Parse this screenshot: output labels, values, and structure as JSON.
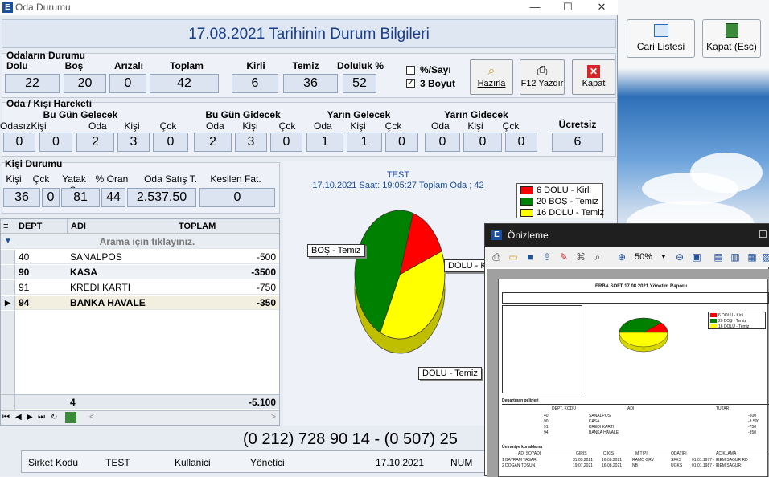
{
  "window": {
    "title": "Oda Durumu",
    "minimize": "—",
    "maximize": "☐",
    "close": "✕"
  },
  "header": {
    "title": "17.08.2021 Tarihinin Durum Bilgileri"
  },
  "odalar": {
    "section_title": "Odaların Durumu",
    "labels": [
      "Dolu",
      "Boş",
      "Arızalı",
      "Toplam",
      "Kirli",
      "Temiz",
      "Doluluk %"
    ],
    "values": [
      "22",
      "20",
      "0",
      "42",
      "6",
      "36",
      "52"
    ],
    "option_yuzde": "%/Sayı",
    "option_3boyut": "3 Boyut",
    "yuzde_checked": false,
    "boyut_checked": true
  },
  "buttons": {
    "hazirla": "Hazırla",
    "yazdir": "F12 Yazdır",
    "kapat": "Kapat"
  },
  "right_buttons": {
    "cari": "Cari Listesi",
    "kapat_esc": "Kapat (Esc)"
  },
  "hareket": {
    "section_title": "Oda / Kişi Hareketi",
    "groups": [
      "Bu Gün Gelecek",
      "Bu Gün Gidecek",
      "Yarın Gelecek",
      "Yarın Gidecek"
    ],
    "col_labels": [
      "Odasız",
      "Kişi",
      "Oda",
      "Kişi",
      "Çck",
      "Oda",
      "Kişi",
      "Çck",
      "Oda",
      "Kişi",
      "Çck",
      "Oda",
      "Kişi",
      "Çck"
    ],
    "values": [
      "0",
      "0",
      "2",
      "3",
      "0",
      "2",
      "3",
      "0",
      "1",
      "1",
      "0",
      "0",
      "0",
      "0"
    ],
    "ucretsiz_label": "Ücretsiz",
    "ucretsiz_value": "6"
  },
  "kisi": {
    "section_title": "Kişi Durumu",
    "labels": [
      "Kişi",
      "Çck",
      "Yatak S.",
      "% Oran",
      "Oda Satış T.",
      "Kesilen Fat."
    ],
    "values": [
      "36",
      "0",
      "81",
      "44",
      "2.537,50",
      "0"
    ]
  },
  "grid": {
    "columns": [
      "DEPT",
      "ADI",
      "TOPLAM"
    ],
    "search_hint": "Arama için tıklayınız.",
    "rows": [
      {
        "dept": "40",
        "adi": "SANALPOS",
        "toplam": "-500",
        "bold": false
      },
      {
        "dept": "90",
        "adi": "KASA",
        "toplam": "-3500",
        "bold": true
      },
      {
        "dept": "91",
        "adi": "KREDI KARTI",
        "toplam": "-750",
        "bold": false
      },
      {
        "dept": "94",
        "adi": "BANKA HAVALE",
        "toplam": "-350",
        "bold": true
      }
    ],
    "footer_count": "4",
    "footer_total": "-5.100"
  },
  "chart_data": {
    "type": "pie",
    "title": "TEST",
    "subtitle": "17.10.2021 Saat: 19:05:27 Toplam Oda ; 42",
    "categories": [
      "DOLU - Kirli",
      "BOŞ - Temiz",
      "DOLU - Temiz"
    ],
    "values": [
      6,
      20,
      16
    ],
    "legend": [
      "6 DOLU - Kirli",
      "20 BOŞ - Temiz",
      "16 DOLU - Temiz"
    ],
    "colors": [
      "#ff0000",
      "#008000",
      "#ffff00"
    ],
    "callouts": [
      "BOŞ - Temiz",
      "DOLU - Kir",
      "DOLU - Temiz"
    ],
    "three_d": true,
    "legend_position": "top-right"
  },
  "phone": {
    "text": "(0 212) 728 90 14   -   (0  507) 25"
  },
  "status": {
    "items": [
      "Sirket Kodu",
      "TEST",
      "Kullanici",
      "Yönetici",
      "17.10.2021",
      "NUM"
    ]
  },
  "preview": {
    "title": "Önizleme",
    "zoom": "50%",
    "report_title": "ERBA SOFT 17.08.2021  Yönetim Raporu",
    "dept_title": "Departman gelirleri",
    "dept_headers": [
      "DEPT. KODU",
      "ADI",
      "TUTAR"
    ],
    "dept_rows": [
      [
        "40",
        "SANALPOS",
        "-500"
      ],
      [
        "90",
        "KASA",
        "-3.500"
      ],
      [
        "91",
        "KREDI KARTI",
        "-750"
      ],
      [
        "94",
        "BANKA HAVALE",
        "-350"
      ]
    ],
    "konak_title": "Ümraniye konaklama",
    "konak_headers": [
      "ADI SOYADI",
      "GIRIS",
      "CIKIS",
      "M.TIPI",
      "ODATIPI",
      "ACIKLAMA"
    ],
    "konak_rows": [
      [
        "1 BAYRAM YASAR",
        "31.03.2021",
        "16.08.2021",
        "RAMO GRV",
        "SFKS",
        "01.01.1977 - IREM SAGUR RD"
      ],
      [
        "2 DOGAN TOSUN",
        "19.07.2021",
        "16.08.2021",
        "NB",
        "UGKS",
        "01.01.1987 - IREM SAGUR"
      ]
    ],
    "legend": [
      "6 DOLU - Kirli",
      "20 BOŞ - Temiz",
      "16 DOLU - Temiz"
    ]
  }
}
